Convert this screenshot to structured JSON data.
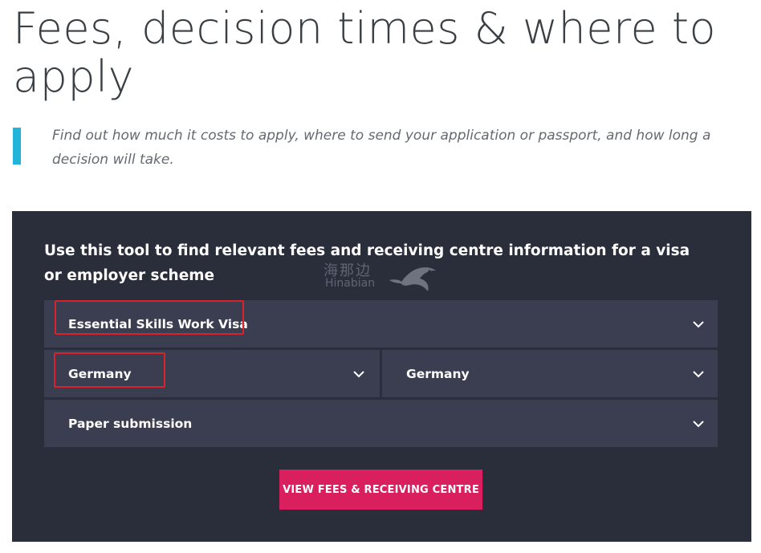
{
  "page": {
    "title": "Fees, decision times & where to apply",
    "intro": "Find out how much it costs to apply, where to send your application or passport, and how long a decision will take."
  },
  "tool": {
    "heading": "Use this tool to find relevant fees and receiving centre information for a visa or employer scheme",
    "visa_select": {
      "value": "Essential Skills Work Visa",
      "icon": "chevron-down-icon"
    },
    "country_select_1": {
      "value": "Germany",
      "icon": "chevron-down-icon"
    },
    "country_select_2": {
      "value": "Germany",
      "icon": "chevron-down-icon"
    },
    "submission_select": {
      "value": "Paper submission",
      "icon": "chevron-down-icon"
    },
    "submit_label": "VIEW FEES & RECEIVING CENTRE"
  },
  "watermark": {
    "chinese": "海那边",
    "latin": "Hinabian"
  },
  "colors": {
    "accent_bar": "#23b5d9",
    "panel_bg": "#2a2d3a",
    "select_bg": "#3b3e51",
    "button_bg": "#d91f5d",
    "highlight_border": "#d8232a"
  }
}
